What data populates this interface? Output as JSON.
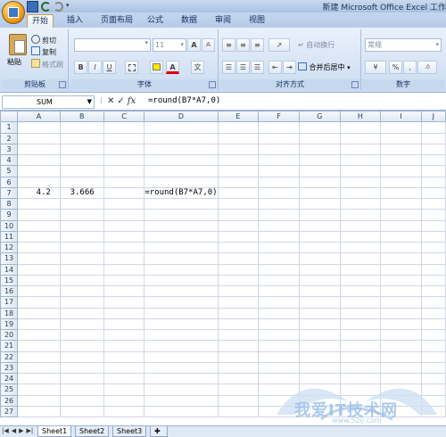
{
  "window": {
    "title": "新建 Microsoft Office Excel 工作"
  },
  "tabs": [
    {
      "label": "开始",
      "active": true
    },
    {
      "label": "插入",
      "active": false
    },
    {
      "label": "页面布局",
      "active": false
    },
    {
      "label": "公式",
      "active": false
    },
    {
      "label": "数据",
      "active": false
    },
    {
      "label": "审阅",
      "active": false
    },
    {
      "label": "视图",
      "active": false
    }
  ],
  "ribbon": {
    "clipboard": {
      "label": "剪贴板",
      "paste": "粘贴",
      "cut": "剪切",
      "copy": "复制",
      "format_painter": "格式刷"
    },
    "font": {
      "label": "字体",
      "size": "11",
      "grow": "A",
      "shrink": "A",
      "bold": "B",
      "italic": "I",
      "underline": "U",
      "font_color": "A"
    },
    "alignment": {
      "label": "对齐方式",
      "wrap_text": "自动换行",
      "merge_center": "合并后居中"
    },
    "number": {
      "label": "数字",
      "format": "常规",
      "percent": "%",
      "comma": ","
    }
  },
  "formula_bar": {
    "name_box": "SUM",
    "formula": "=round(B7*A7,0)"
  },
  "sheet": {
    "columns": [
      "A",
      "B",
      "C",
      "D",
      "E",
      "F",
      "G",
      "H",
      "I",
      "J"
    ],
    "rows": [
      "1",
      "2",
      "3",
      "4",
      "5",
      "6",
      "7",
      "8",
      "9",
      "10",
      "11",
      "12",
      "13",
      "14",
      "15",
      "16",
      "17",
      "18",
      "19",
      "20",
      "21",
      "22",
      "23",
      "24",
      "25",
      "26",
      "27"
    ],
    "cells": {
      "A7": "4.2",
      "B7": "3.666",
      "D7": "=round(B7*A7,0)"
    }
  },
  "sheet_tabs": [
    {
      "label": "Sheet1",
      "active": true
    },
    {
      "label": "Sheet2",
      "active": false
    },
    {
      "label": "Sheet3",
      "active": false
    }
  ],
  "watermark": {
    "text": "我爱IT技术网",
    "url": "www.52ij.com"
  },
  "colors": {
    "ribbon_bg": "#d4e2f4",
    "accent": "#15305b",
    "grid_line": "#d0d7e5"
  }
}
